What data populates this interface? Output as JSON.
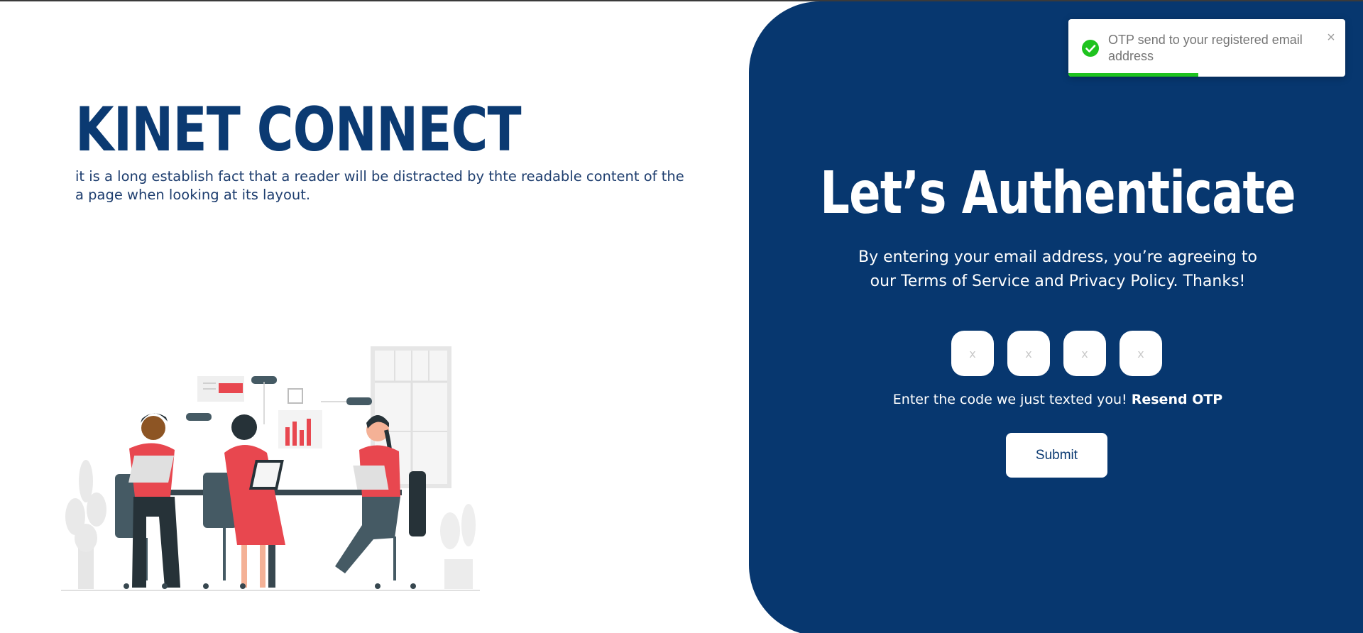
{
  "brand": {
    "title": "KINET CONNECT",
    "tagline": "it is a long establish fact that a reader will be distracted by thte readable content of the a page when looking at its layout."
  },
  "auth_panel": {
    "title": "Let’s Authenticate",
    "description": "By entering your email address, you’re agreeing to our Terms of Service and Privacy Policy. Thanks!",
    "otp_inputs": [
      {
        "placeholder": "x",
        "value": ""
      },
      {
        "placeholder": "x",
        "value": ""
      },
      {
        "placeholder": "x",
        "value": ""
      },
      {
        "placeholder": "x",
        "value": ""
      }
    ],
    "code_prompt": "Enter the code we just texted you!",
    "resend_label": "Resend OTP",
    "submit_label": "Submit"
  },
  "toast": {
    "icon": "check-circle-icon",
    "message": "OTP send to your registered email address",
    "close_glyph": "×",
    "progress_fraction": 0.47,
    "accent": "#1ec31e"
  },
  "colors": {
    "panel_bg": "#07376f",
    "brand_text": "#0b3a72",
    "accent_red": "#e8474f"
  }
}
